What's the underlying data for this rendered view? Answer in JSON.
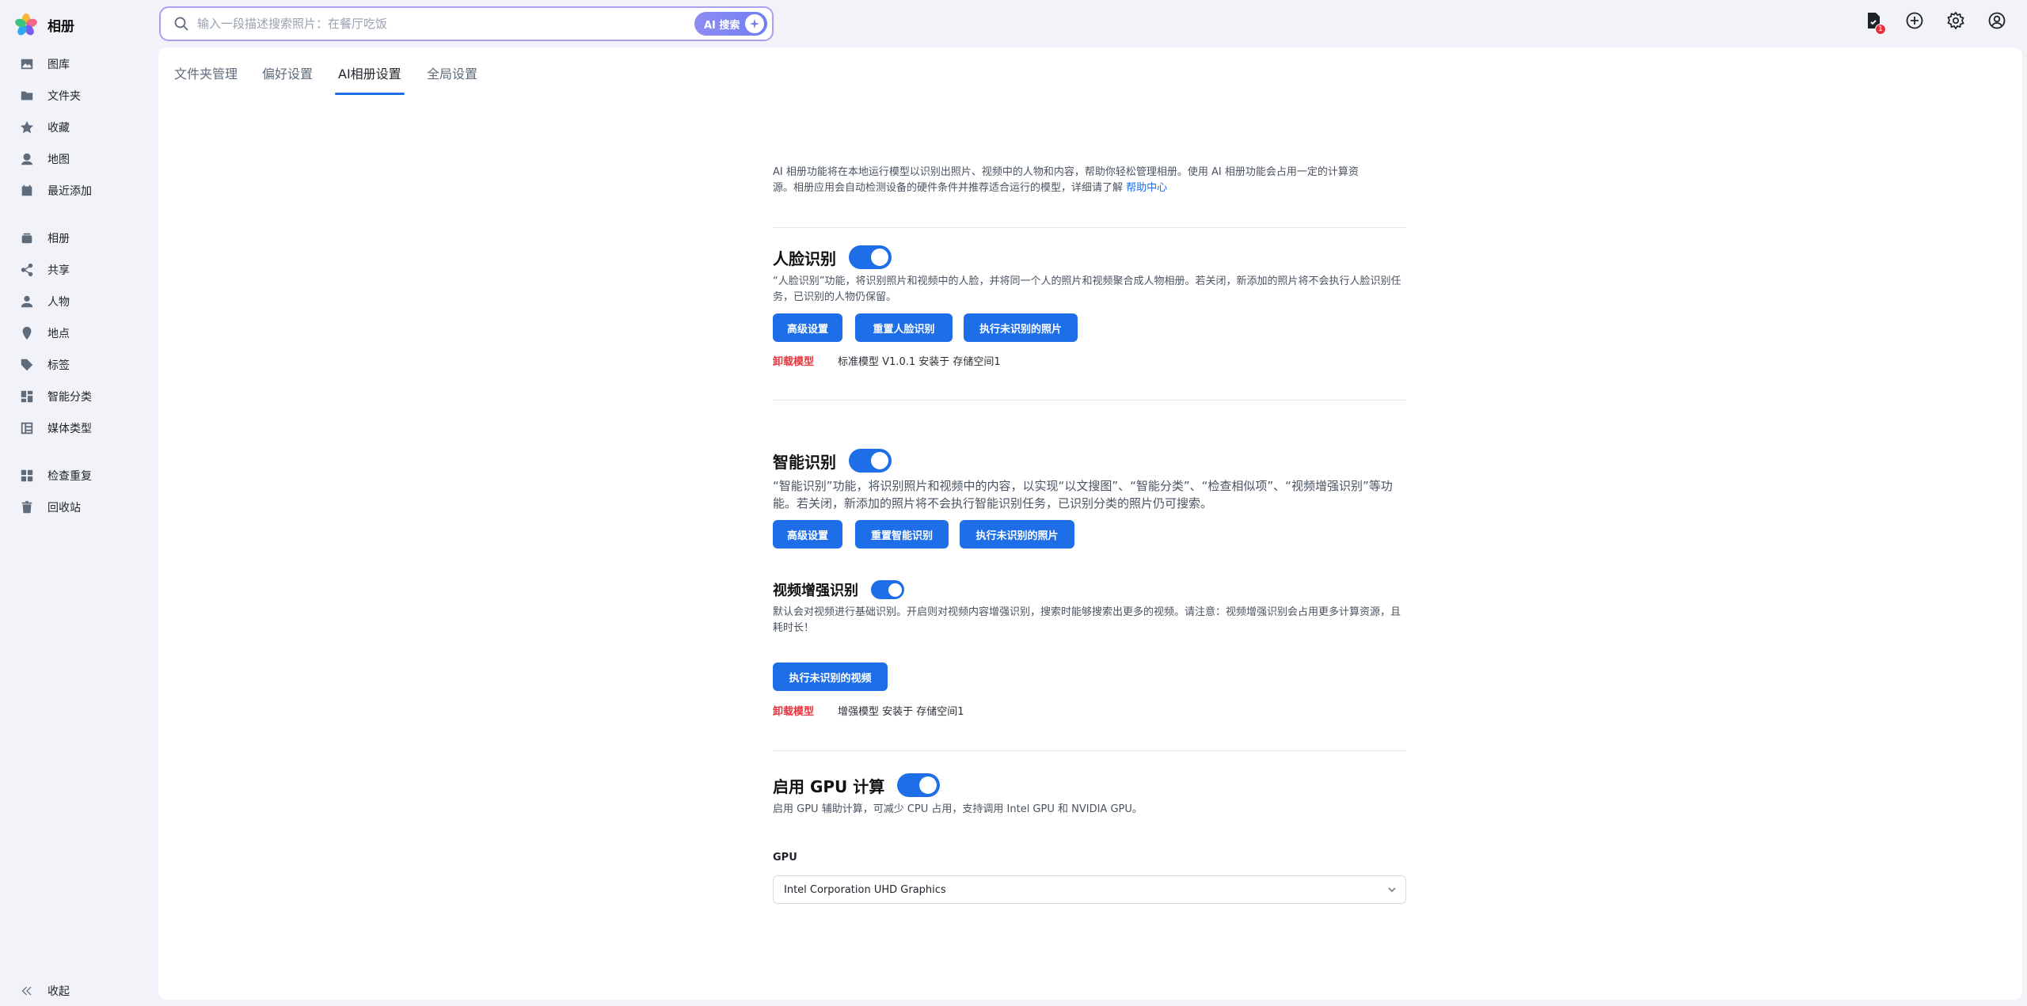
{
  "app": {
    "name": "相册"
  },
  "sidebar": {
    "items": [
      {
        "label": "图库",
        "icon": "image-icon"
      },
      {
        "label": "文件夹",
        "icon": "folder-icon"
      },
      {
        "label": "收藏",
        "icon": "star-icon"
      },
      {
        "label": "地图",
        "icon": "map-icon"
      },
      {
        "label": "最近添加",
        "icon": "calendar-icon"
      },
      {
        "label": "相册",
        "icon": "album-icon"
      },
      {
        "label": "共享",
        "icon": "share-icon"
      },
      {
        "label": "人物",
        "icon": "person-icon"
      },
      {
        "label": "地点",
        "icon": "pin-icon"
      },
      {
        "label": "标签",
        "icon": "tag-icon"
      },
      {
        "label": "智能分类",
        "icon": "grid-icon"
      },
      {
        "label": "媒体类型",
        "icon": "media-icon"
      },
      {
        "label": "检查重复",
        "icon": "duplicate-icon"
      },
      {
        "label": "回收站",
        "icon": "trash-icon"
      }
    ],
    "collapse_label": "收起"
  },
  "search": {
    "placeholder": "输入一段描述搜索照片：在餐厅吃饭",
    "ai_button": "AI 搜索"
  },
  "topbar": {
    "notification_count": "1"
  },
  "tabs": [
    {
      "label": "文件夹管理"
    },
    {
      "label": "偏好设置"
    },
    {
      "label": "AI相册设置"
    },
    {
      "label": "全局设置"
    }
  ],
  "intro": {
    "line1": "AI 相册功能将在本地运行模型以识别出照片、视频中的人物和内容，帮助你轻松管理相册。使用 AI 相册功能会占用一定的计算资",
    "line2": "源。相册应用会自动检测设备的硬件条件并推荐适合运行的模型，详细请了解 ",
    "link": "帮助中心"
  },
  "face": {
    "title": "人脸识别",
    "enabled": true,
    "desc": "“人脸识别”功能，将识别照片和视频中的人脸，并将同一个人的照片和视频聚合成人物相册。若关闭，新添加的照片将不会执行人脸识别任务，已识别的人物仍保留。",
    "buttons": [
      "高级设置",
      "重置人脸识别",
      "执行未识别的照片"
    ],
    "uninstall": "卸载模型",
    "model_info": "标准模型 V1.0.1 安装于 存储空间1"
  },
  "smart": {
    "title": "智能识别",
    "enabled": true,
    "desc": "“智能识别”功能，将识别照片和视频中的内容，以实现“以文搜图”、“智能分类”、“检查相似项”、“视频增强识别”等功能。若关闭，新添加的照片将不会执行智能识别任务，已识别分类的照片仍可搜索。",
    "buttons": [
      "高级设置",
      "重置智能识别",
      "执行未识别的照片"
    ]
  },
  "video": {
    "title": "视频增强识别",
    "enabled": true,
    "desc": "默认会对视频进行基础识别。开启则对视频内容增强识别，搜索时能够搜索出更多的视频。请注意：视频增强识别会占用更多计算资源，且耗时长！",
    "button": "执行未识别的视频",
    "uninstall": "卸载模型",
    "model_info": "增强模型 安装于 存储空间1"
  },
  "gpu": {
    "title": "启用 GPU 计算",
    "enabled": true,
    "desc": "启用 GPU 辅助计算，可减少 CPU 占用，支持调用 Intel GPU 和 NVIDIA GPU。",
    "label": "GPU",
    "selected": "Intel Corporation UHD Graphics"
  },
  "colors": {
    "accent": "#1e6ee8",
    "danger": "#e8323c",
    "background": "#f1f3f8"
  }
}
